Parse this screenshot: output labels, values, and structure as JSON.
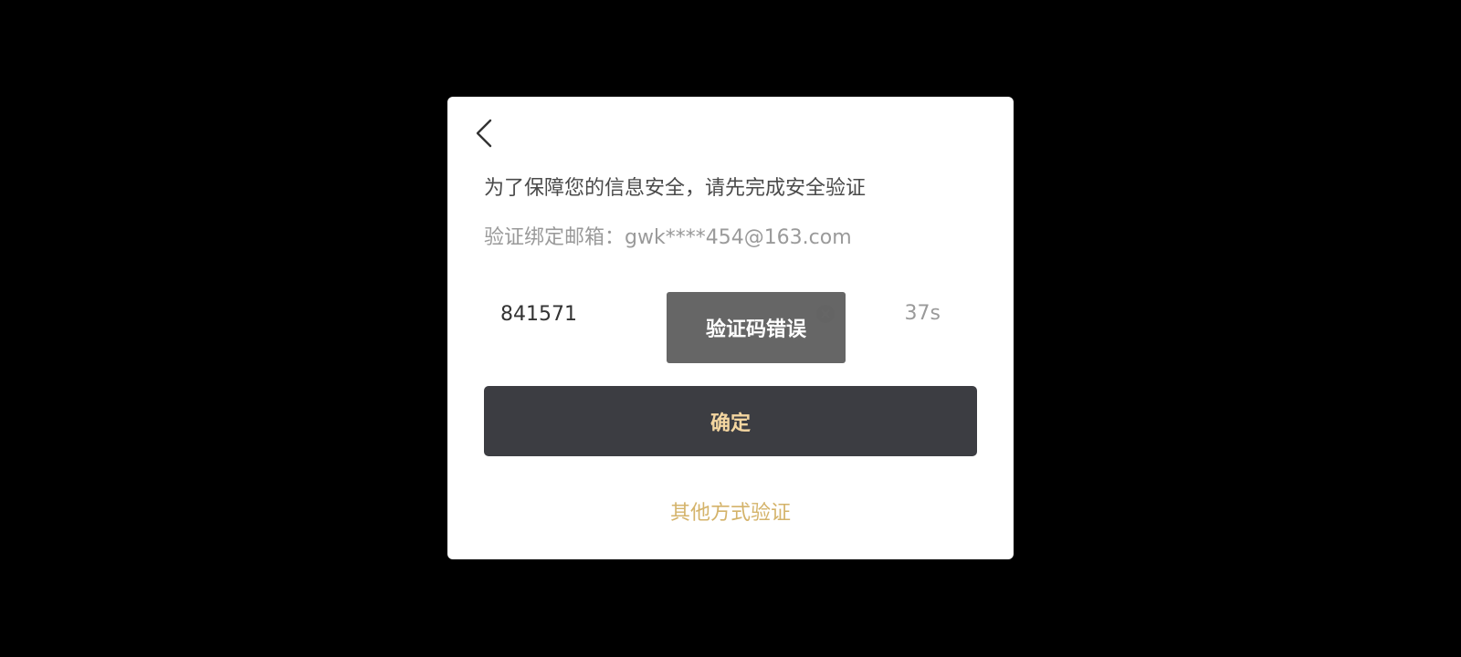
{
  "dialog": {
    "title": "为了保障您的信息安全，请先完成安全验证",
    "subtitle": "验证绑定邮箱：gwk****454@163.com",
    "code_value": "841571",
    "countdown": "37s",
    "toast": "验证码错误",
    "confirm_label": "确定",
    "other_method_label": "其他方式验证"
  },
  "icons": {
    "back": "chevron-left-icon",
    "clear": "clear-circle-icon"
  },
  "colors": {
    "background": "#000000",
    "dialog_bg": "#ffffff",
    "button_bg": "#3c3d42",
    "button_text": "#f4d6a0",
    "link_text": "#d4b36a",
    "toast_bg": "#606060"
  }
}
